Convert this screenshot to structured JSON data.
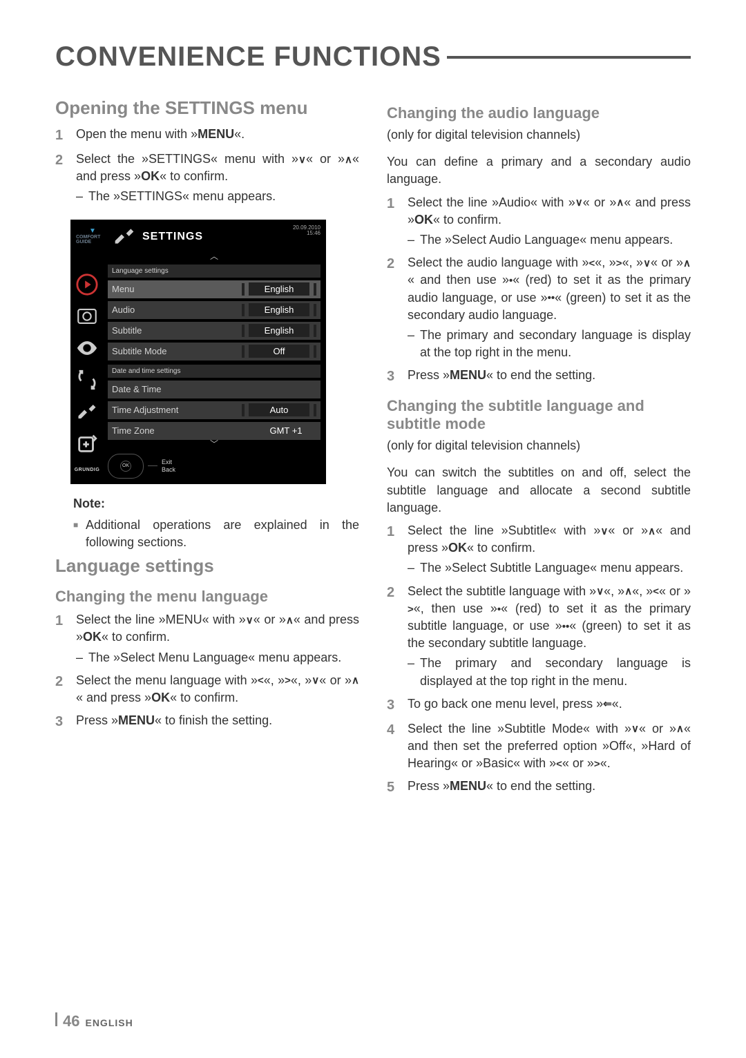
{
  "title": "CONVENIENCE FUNCTIONS",
  "footer": {
    "page": "46",
    "lang": "ENGLISH"
  },
  "left": {
    "h2": "Opening the SETTINGS menu",
    "steps": [
      {
        "num": "1",
        "body": "Open the menu with »MENU«.",
        "bold": [
          "MENU"
        ]
      },
      {
        "num": "2",
        "body": "Select the »SETTINGS« menu with »∨« or »∧« and press »OK« to confirm.",
        "sub": "The »SETTINGS« menu appears."
      }
    ],
    "note": {
      "title": "Note:",
      "body": "Additional operations are explained in the following sections."
    },
    "lang_h2": "Language settings",
    "lang_h3": "Changing the menu language",
    "lang_steps": [
      {
        "num": "1",
        "body": "Select the line »MENU« with »∨« or »∧« and press »OK« to confirm.",
        "sub": "The »Select Menu Language« menu appears."
      },
      {
        "num": "2",
        "body": "Select the menu language with »<«, »>«, »∨« or »∧« and press »OK« to confirm."
      },
      {
        "num": "3",
        "body": "Press »MENU« to finish the setting."
      }
    ]
  },
  "tv": {
    "comfort": "COMFORT GUIDE",
    "title": "SETTINGS",
    "date": "20.09.2010",
    "time": "15:46",
    "sec1": "Language settings",
    "rows1": [
      {
        "k": "Menu",
        "v": "English"
      },
      {
        "k": "Audio",
        "v": "English"
      },
      {
        "k": "Subtitle",
        "v": "English"
      },
      {
        "k": "Subtitle Mode",
        "v": "Off"
      }
    ],
    "sec2": "Date and time settings",
    "rows2": [
      {
        "k": "Date & Time",
        "v": ""
      },
      {
        "k": "Time Adjustment",
        "v": "Auto"
      },
      {
        "k": "Time Zone",
        "v": "GMT +1"
      }
    ],
    "exit": "Exit",
    "back": "Back",
    "brand": "GRUNDIG"
  },
  "right": {
    "h3a": "Changing the audio language",
    "suba": "(only for digital television channels)",
    "pa": "You can define a primary and a secondary audio language.",
    "steps_a": [
      {
        "num": "1",
        "body": "Select the line »Audio« with »∨« or »∧« and press »OK« to confirm.",
        "sub": "The »Select Audio Language« menu appears."
      },
      {
        "num": "2",
        "body": "Select the audio language with »<«, »>«, »∨« or »∧« and then use »•« (red) to set it as the primary audio language, or use »••« (green) to set it as the secondary audio language.",
        "sub": "The primary and secondary language is display at the top right in the menu."
      },
      {
        "num": "3",
        "body": "Press »MENU« to end the setting."
      }
    ],
    "h3b": "Changing the subtitle language and subtitle mode",
    "subb": "(only for digital television channels)",
    "pb": "You can switch the subtitles on and off, select the subtitle language and allocate a second subtitle language.",
    "steps_b": [
      {
        "num": "1",
        "body": "Select the line »Subtitle« with »∨« or »∧« and press »OK« to confirm.",
        "sub": "The »Select Subtitle Language« menu appears."
      },
      {
        "num": "2",
        "body": "Select the subtitle language with »∨«, »∧«, »<« or »>«, then use »•« (red) to set it as the primary subtitle language, or use »••« (green) to set it as the secondary subtitle language.",
        "sub": "The primary and secondary language is displayed at the top right in the menu."
      },
      {
        "num": "3",
        "body": "To go back one menu level, press »⇐«."
      },
      {
        "num": "4",
        "body": "Select the line »Subtitle Mode« with »∨« or »∧« and then set the preferred option »Off«, »Hard of Hearing« or »Basic« with »<« or »>«."
      },
      {
        "num": "5",
        "body": "Press »MENU« to end the setting."
      }
    ]
  }
}
